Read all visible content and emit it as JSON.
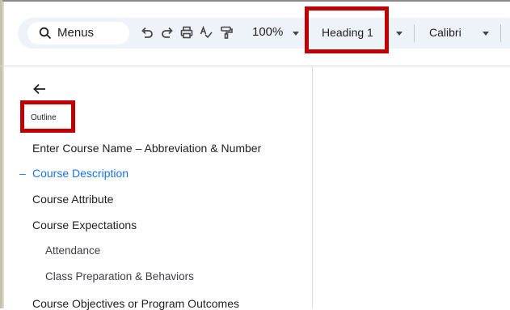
{
  "toolbar": {
    "menus_label": "Menus",
    "zoom": "100%",
    "style": "Heading 1",
    "font": "Calibri"
  },
  "outline": {
    "title": "Outline",
    "items": [
      {
        "label": "Enter Course Name – Abbreviation & Number"
      },
      {
        "label": "Course Description",
        "active": true
      },
      {
        "label": "Course Attribute"
      },
      {
        "label": "Course Expectations"
      },
      {
        "label": "Attendance",
        "level": 2
      },
      {
        "label": "Class Preparation & Behaviors",
        "level": 2
      },
      {
        "label": "Course Objectives or Program Outcomes"
      }
    ]
  },
  "icons": [
    "search-icon",
    "undo-icon",
    "redo-icon",
    "print-icon",
    "spellcheck-icon",
    "paint-format-icon",
    "back-arrow-icon"
  ],
  "colors": {
    "highlight": "#c00000",
    "active_link": "#1a73e8",
    "toolbar_bg": "#eef2f9"
  }
}
